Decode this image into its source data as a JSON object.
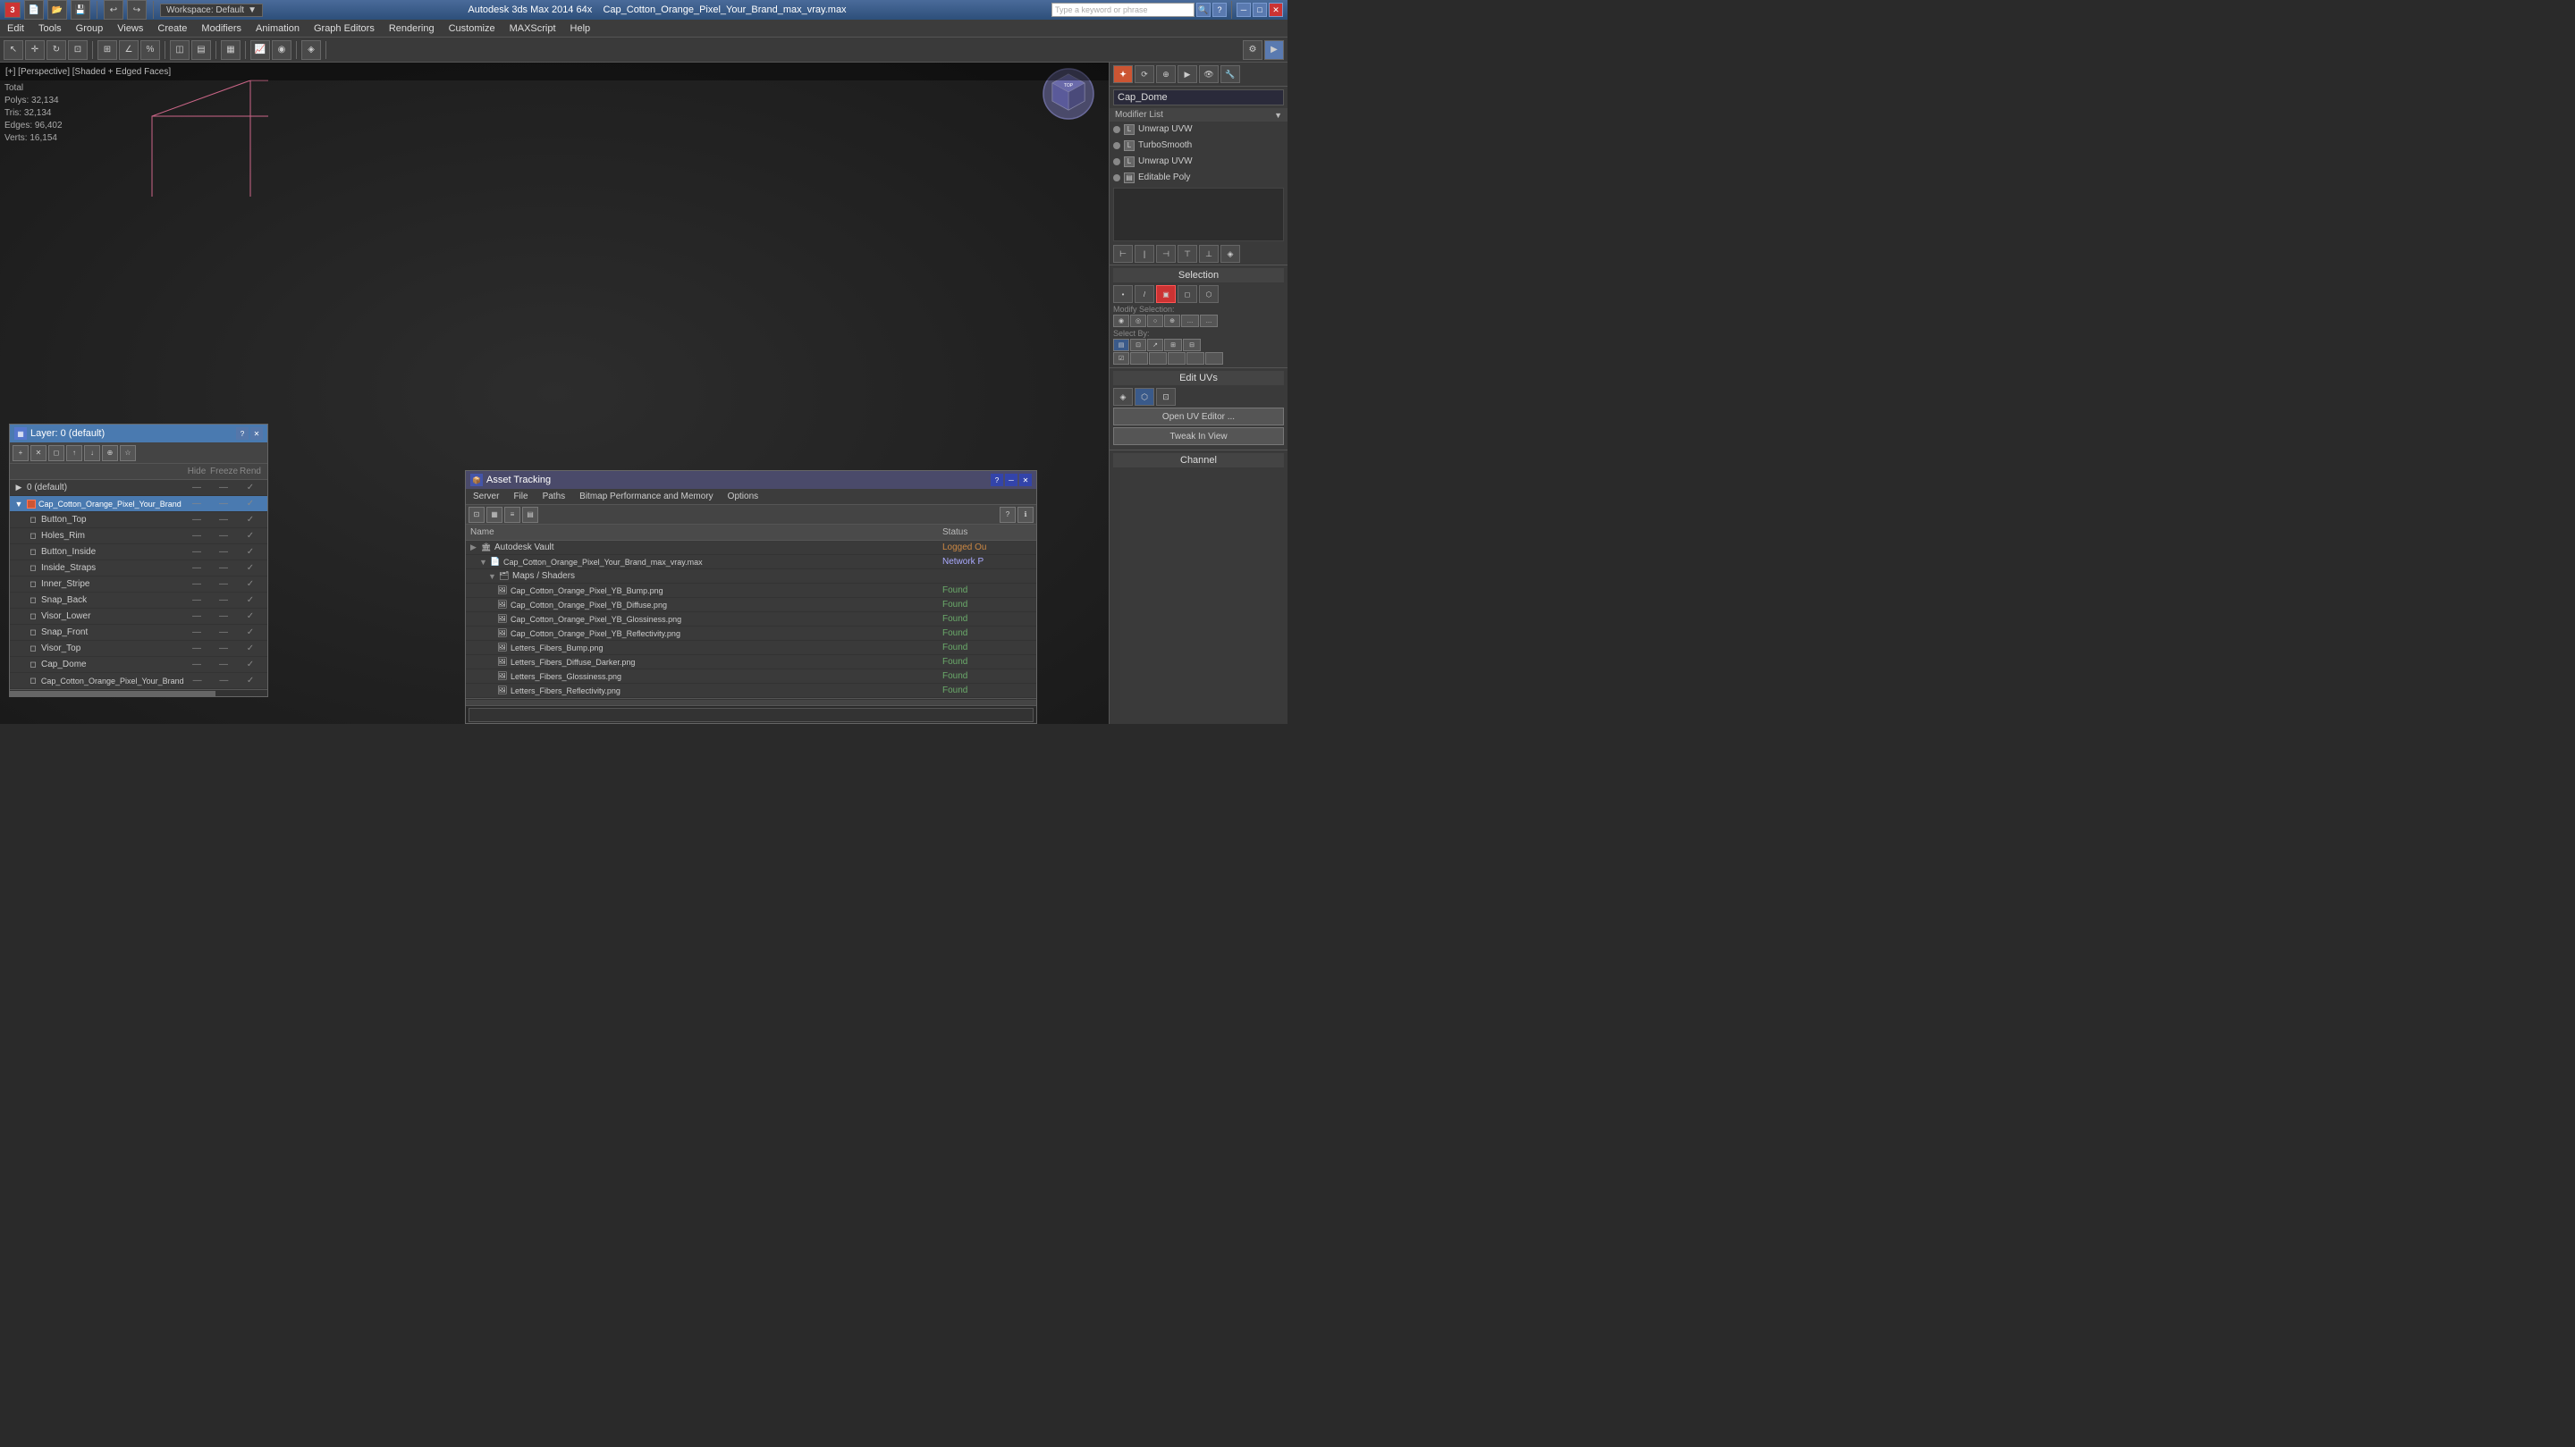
{
  "app": {
    "title": "Autodesk 3ds Max 2014 64x",
    "file": "Cap_Cotton_Orange_Pixel_Your_Brand_max_vray.max",
    "search_placeholder": "Type a keyword or phrase"
  },
  "title_bar": {
    "workspace_label": "Workspace: Default",
    "min_btn": "─",
    "max_btn": "□",
    "close_btn": "✕"
  },
  "menu": {
    "items": [
      "Edit",
      "Tools",
      "Group",
      "Views",
      "Create",
      "Modifiers",
      "Animation",
      "Graph Editors",
      "Rendering",
      "Customize",
      "MAXScript",
      "Help"
    ]
  },
  "viewport": {
    "header": "[+] [Perspective] [Shaded + Edged Faces]",
    "stats": {
      "polys_label": "Total",
      "polys_key": "Polys:",
      "polys_val": "32,134",
      "tris_key": "Tris:",
      "tris_val": "32,134",
      "edges_key": "Edges:",
      "edges_val": "96,402",
      "verts_key": "Verts:",
      "verts_val": "16,154"
    }
  },
  "right_panel": {
    "object_name": "Cap_Dome",
    "modifier_list_label": "Modifier List",
    "modifiers": [
      {
        "name": "Unwrap UVW",
        "active": false
      },
      {
        "name": "TurboSmooth",
        "active": false
      },
      {
        "name": "Unwrap UVW",
        "active": false
      },
      {
        "name": "Editable Poly",
        "active": false
      }
    ],
    "selection_title": "Selection",
    "select_by_label": "Select By:",
    "modify_selection_label": "Modify Selection:",
    "edit_uvs_title": "Edit UVs",
    "open_uv_editor_btn": "Open UV Editor ...",
    "tweak_in_view_btn": "Tweak In View",
    "channel_title": "Channel"
  },
  "layers": {
    "title": "Layer: 0 (default)",
    "headers": {
      "name": "",
      "hide": "Hide",
      "freeze": "Freeze",
      "render": "Rend"
    },
    "items": [
      {
        "name": "0 (default)",
        "level": 0,
        "selected": false
      },
      {
        "name": "Cap_Cotton_Orange_Pixel_Your_Brand",
        "level": 1,
        "selected": true
      },
      {
        "name": "Button_Top",
        "level": 2,
        "selected": false
      },
      {
        "name": "Holes_Rim",
        "level": 2,
        "selected": false
      },
      {
        "name": "Button_Inside",
        "level": 2,
        "selected": false
      },
      {
        "name": "Inside_Straps",
        "level": 2,
        "selected": false
      },
      {
        "name": "Inner_Stripe",
        "level": 2,
        "selected": false
      },
      {
        "name": "Snap_Back",
        "level": 2,
        "selected": false
      },
      {
        "name": "Visor_Lower",
        "level": 2,
        "selected": false
      },
      {
        "name": "Snap_Front",
        "level": 2,
        "selected": false
      },
      {
        "name": "Visor_Top",
        "level": 2,
        "selected": false
      },
      {
        "name": "Cap_Dome",
        "level": 2,
        "selected": false
      },
      {
        "name": "Cap_Cotton_Orange_Pixel_Your_Brand",
        "level": 2,
        "selected": false
      }
    ]
  },
  "asset_tracking": {
    "title": "Asset Tracking",
    "menu_items": [
      "Server",
      "File",
      "Paths",
      "Bitmap Performance and Memory",
      "Options"
    ],
    "table_headers": {
      "name": "Name",
      "status": "Status"
    },
    "items": [
      {
        "name": "Autodesk Vault",
        "level": 0,
        "status": "Logged Ou",
        "is_group": true,
        "expandable": true
      },
      {
        "name": "Cap_Cotton_Orange_Pixel_Your_Brand_max_vray.max",
        "level": 1,
        "status": "Network P",
        "is_group": false,
        "expandable": true
      },
      {
        "name": "Maps / Shaders",
        "level": 2,
        "status": "",
        "is_group": true,
        "expandable": true
      },
      {
        "name": "Cap_Cotton_Orange_Pixel_YB_Bump.png",
        "level": 3,
        "status": "Found",
        "is_group": false
      },
      {
        "name": "Cap_Cotton_Orange_Pixel_YB_Diffuse.png",
        "level": 3,
        "status": "Found",
        "is_group": false
      },
      {
        "name": "Cap_Cotton_Orange_Pixel_YB_Glossiness.png",
        "level": 3,
        "status": "Found",
        "is_group": false
      },
      {
        "name": "Cap_Cotton_Orange_Pixel_YB_Reflectivity.png",
        "level": 3,
        "status": "Found",
        "is_group": false
      },
      {
        "name": "Letters_Fibers_Bump.png",
        "level": 3,
        "status": "Found",
        "is_group": false
      },
      {
        "name": "Letters_Fibers_Diffuse_Darker.png",
        "level": 3,
        "status": "Found",
        "is_group": false
      },
      {
        "name": "Letters_Fibers_Glossiness.png",
        "level": 3,
        "status": "Found",
        "is_group": false
      },
      {
        "name": "Letters_Fibers_Reflectivity.png",
        "level": 3,
        "status": "Found",
        "is_group": false
      }
    ]
  }
}
